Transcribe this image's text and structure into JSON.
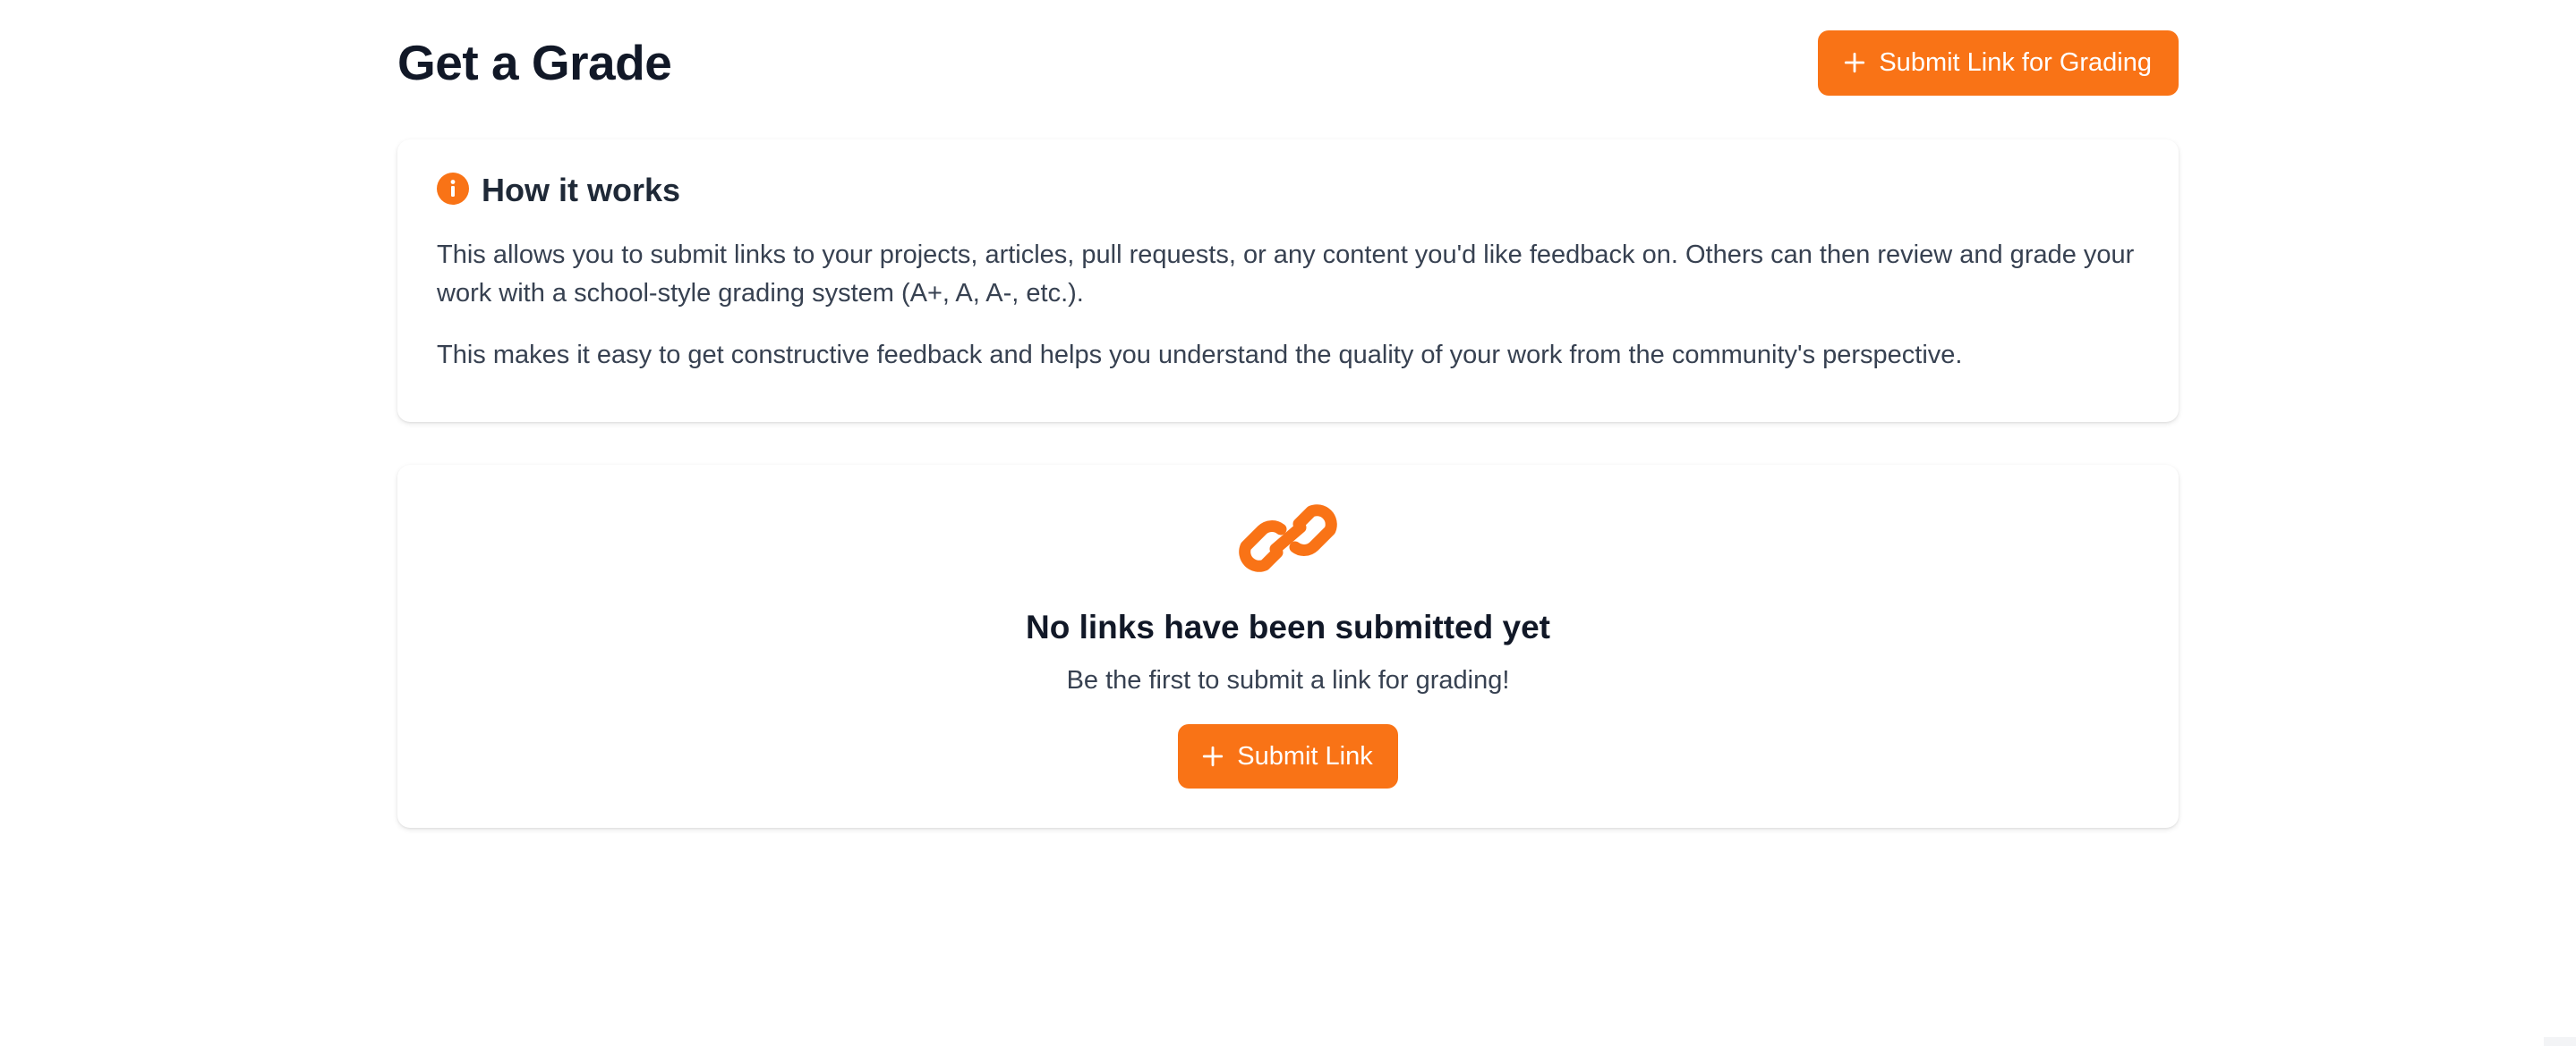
{
  "header": {
    "title": "Get a Grade",
    "submit_button_label": "Submit Link for Grading"
  },
  "how_it_works": {
    "title": "How it works",
    "paragraph_1": "This allows you to submit links to your projects, articles, pull requests, or any content you'd like feedback on. Others can then review and grade your work with a school-style grading system (A+, A, A-, etc.).",
    "paragraph_2": "This makes it easy to get constructive feedback and helps you understand the quality of your work from the community's perspective."
  },
  "empty_state": {
    "icon": "link-icon",
    "title": "No links have been submitted yet",
    "subtitle": "Be the first to submit a link for grading!",
    "button_label": "Submit Link"
  },
  "colors": {
    "accent": "#f97316",
    "text_primary": "#111827",
    "text_secondary": "#374151"
  }
}
